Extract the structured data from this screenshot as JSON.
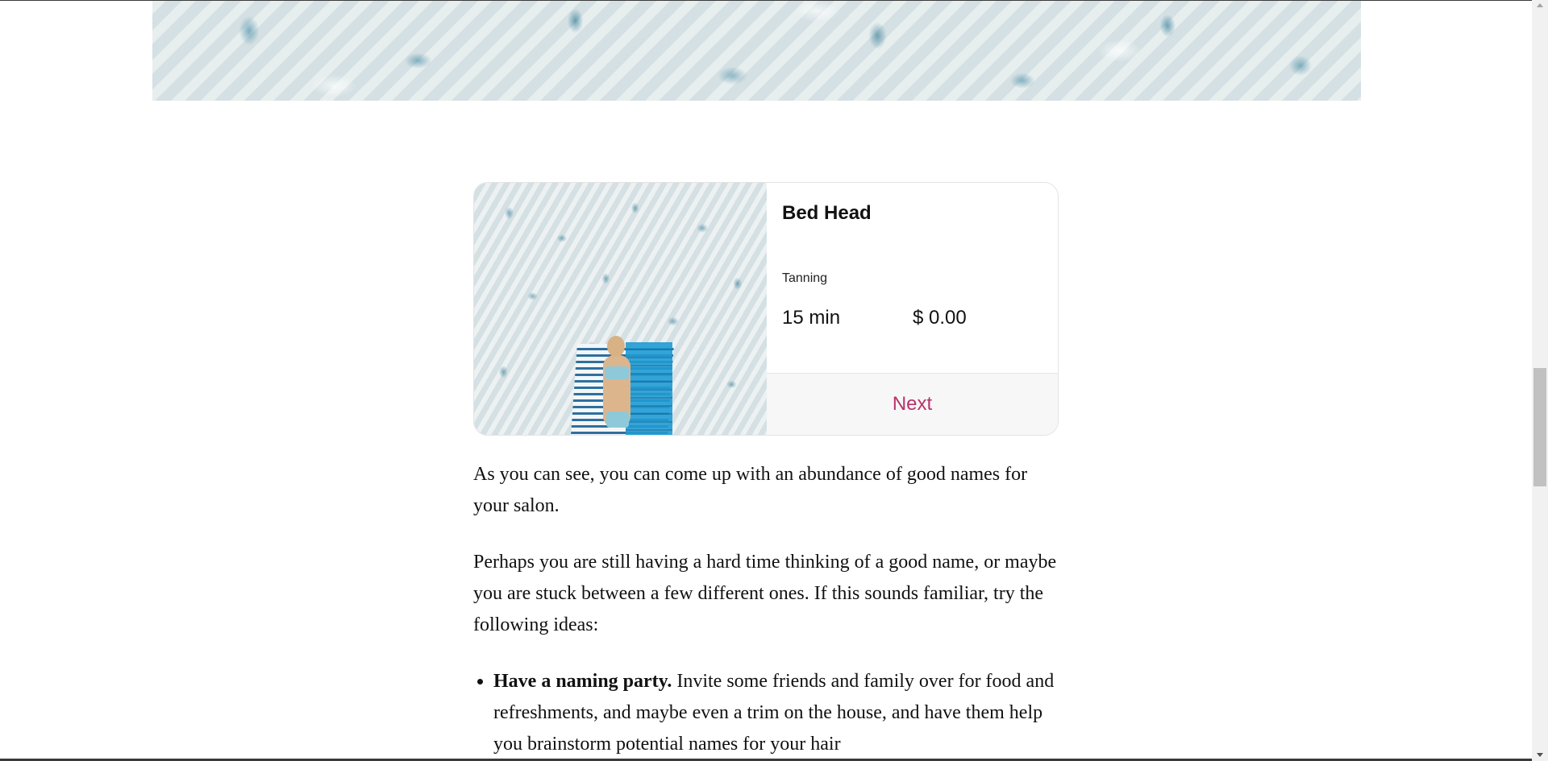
{
  "card": {
    "title": "Bed Head",
    "category": "Tanning",
    "duration": "15 min",
    "price": "$ 0.00",
    "next_label": "Next",
    "accent_color": "#b8336a"
  },
  "article": {
    "paragraphs": [
      "As you can see, you can come up with an abundance of good names for your salon.",
      "Perhaps you are still having a hard time thinking of a good name, or maybe you are stuck between a few different ones. If this sounds familiar, try the following ideas:"
    ],
    "list": [
      {
        "bold": "Have a naming party.",
        "text": " Invite some friends and family over for food and refreshments, and maybe even a trim on the house, and have them help you brainstorm potential names for your hair"
      }
    ]
  }
}
